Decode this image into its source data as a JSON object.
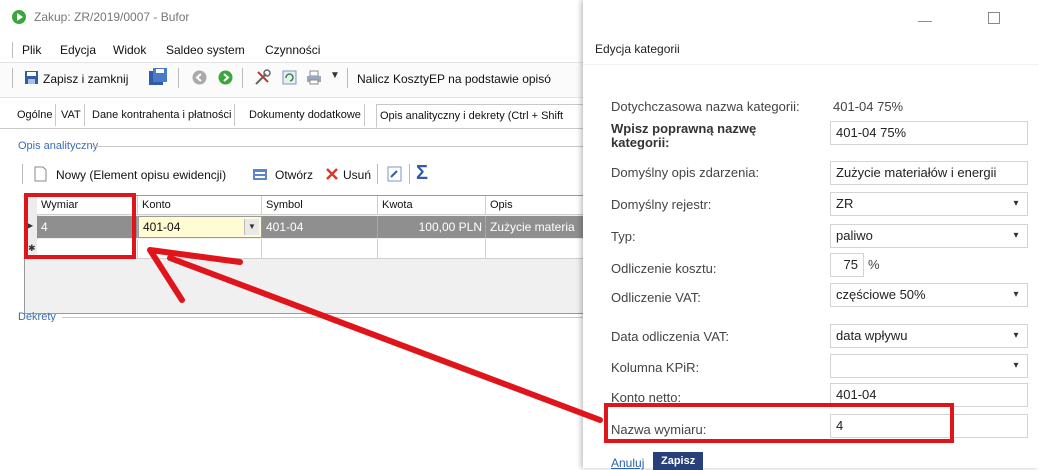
{
  "window": {
    "title": "Zakup: ZR/2019/0007 - Bufor"
  },
  "menu": [
    "Plik",
    "Edycja",
    "Widok",
    "Saldeo system",
    "Czynności"
  ],
  "toolbar": {
    "save_close": "Zapisz i zamknij",
    "calc_label": "Nalicz KosztyEP na podstawie opisó"
  },
  "tabs": [
    "Ogólne",
    "VAT",
    "Dane kontrahenta i płatności",
    "Dokumenty dodatkowe",
    "Opis analityczny i dekrety (Ctrl + Shift"
  ],
  "section": {
    "opis": "Opis analityczny",
    "dekrety": "Dekrety"
  },
  "grid_toolbar": {
    "new": "Nowy (Element opisu ewidencji)",
    "open": "Otwórz",
    "delete": "Usuń",
    "sigma": "Σ"
  },
  "grid": {
    "headers": [
      "Wymiar",
      "Konto",
      "Symbol",
      "Kwota",
      "Opis"
    ],
    "row": {
      "wymiar": "4",
      "konto": "401-04",
      "symbol": "401-04",
      "kwota": "100,00 PLN",
      "opis": "Zużycie materia"
    }
  },
  "dialog": {
    "title": "Edycja kategorii",
    "prev_label": "Dotychczasowa nazwa kategorii:",
    "prev_value": "401-04 75%",
    "name_label": "Wpisz poprawną nazwę kategorii:",
    "name_value": "401-04 75%",
    "event_label": "Domyślny opis zdarzenia:",
    "event_value": "Zużycie materiałów i energii",
    "register_label": "Domyślny rejestr:",
    "register_value": "ZR",
    "type_label": "Typ:",
    "type_value": "paliwo",
    "cost_label": "Odliczenie kosztu:",
    "cost_value": "75",
    "cost_unit": "%",
    "vat_label": "Odliczenie VAT:",
    "vat_value": "częściowe 50%",
    "vat_date_label": "Data odliczenia VAT:",
    "vat_date_value": "data wpływu",
    "kpir_label": "Kolumna KPiR:",
    "kpir_value": "",
    "netto_label": "Konto netto:",
    "netto_value": "401-04",
    "dim_label": "Nazwa wymiaru:",
    "dim_value": "4",
    "cancel": "Anuluj",
    "save": "Zapisz"
  },
  "colors": {
    "highlight": "#e0151b",
    "accent": "#28407a",
    "link": "#2b5fb5"
  }
}
